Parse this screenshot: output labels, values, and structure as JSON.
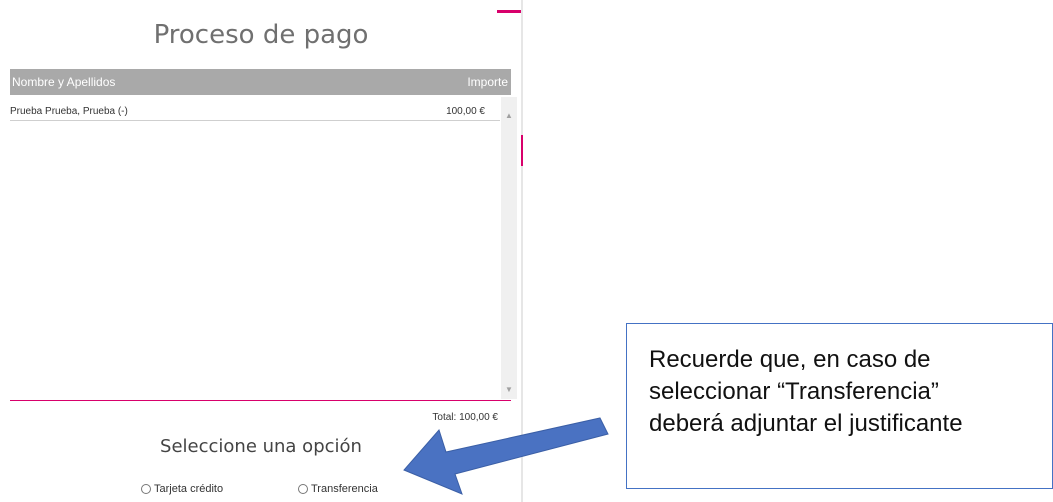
{
  "page": {
    "title": "Proceso de pago"
  },
  "table": {
    "headers": {
      "name": "Nombre y Apellidos",
      "amount": "Importe"
    },
    "rows": [
      {
        "name": "Prueba Prueba, Prueba (-)",
        "amount": "100,00 €"
      }
    ]
  },
  "total": "Total: 100,00 €",
  "payment": {
    "heading": "Seleccione una opción",
    "options": [
      {
        "label": "Tarjeta crédito",
        "selected": false
      },
      {
        "label": "Transferencia",
        "selected": false
      }
    ]
  },
  "callout": {
    "text": "Recuerde que, en caso de\nseleccionar “Transferencia”\ndeberá adjuntar el justificante"
  },
  "colors": {
    "accent": "#d8006b",
    "header_bg": "#a9a9a9",
    "callout_border": "#4472c4",
    "arrow": "#4a72c2"
  },
  "icons": {
    "scroll_up": "triangle-up",
    "scroll_down": "triangle-down",
    "radio": "radio-circle",
    "annotation": "arrow-pointing-left-down"
  }
}
